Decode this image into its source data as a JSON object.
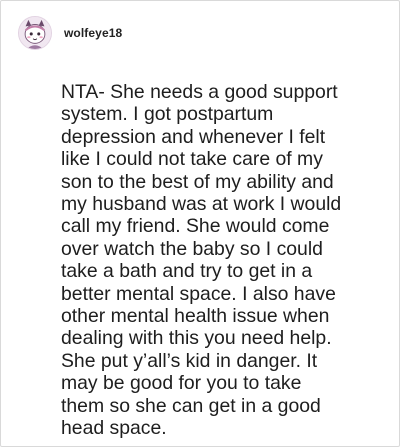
{
  "post": {
    "username": "wolfeye18",
    "avatar_icon": "cartoon-avatar-icon",
    "comment_text": "NTA- She needs a good support\nsystem. I got postpartum\ndepression and whenever I felt\nlike I could not take care of my\nson to the best of my ability and\nmy husband was at work I would\ncall my friend. She would come\nover watch the baby so I could\ntake a bath and try to get in a\nbetter mental space. I also have\nother mental health issue when\ndealing with this you need help.\nShe put y’all’s kid in danger. It\nmay be good for you to take\nthem so she can get in a good\nhead space."
  }
}
